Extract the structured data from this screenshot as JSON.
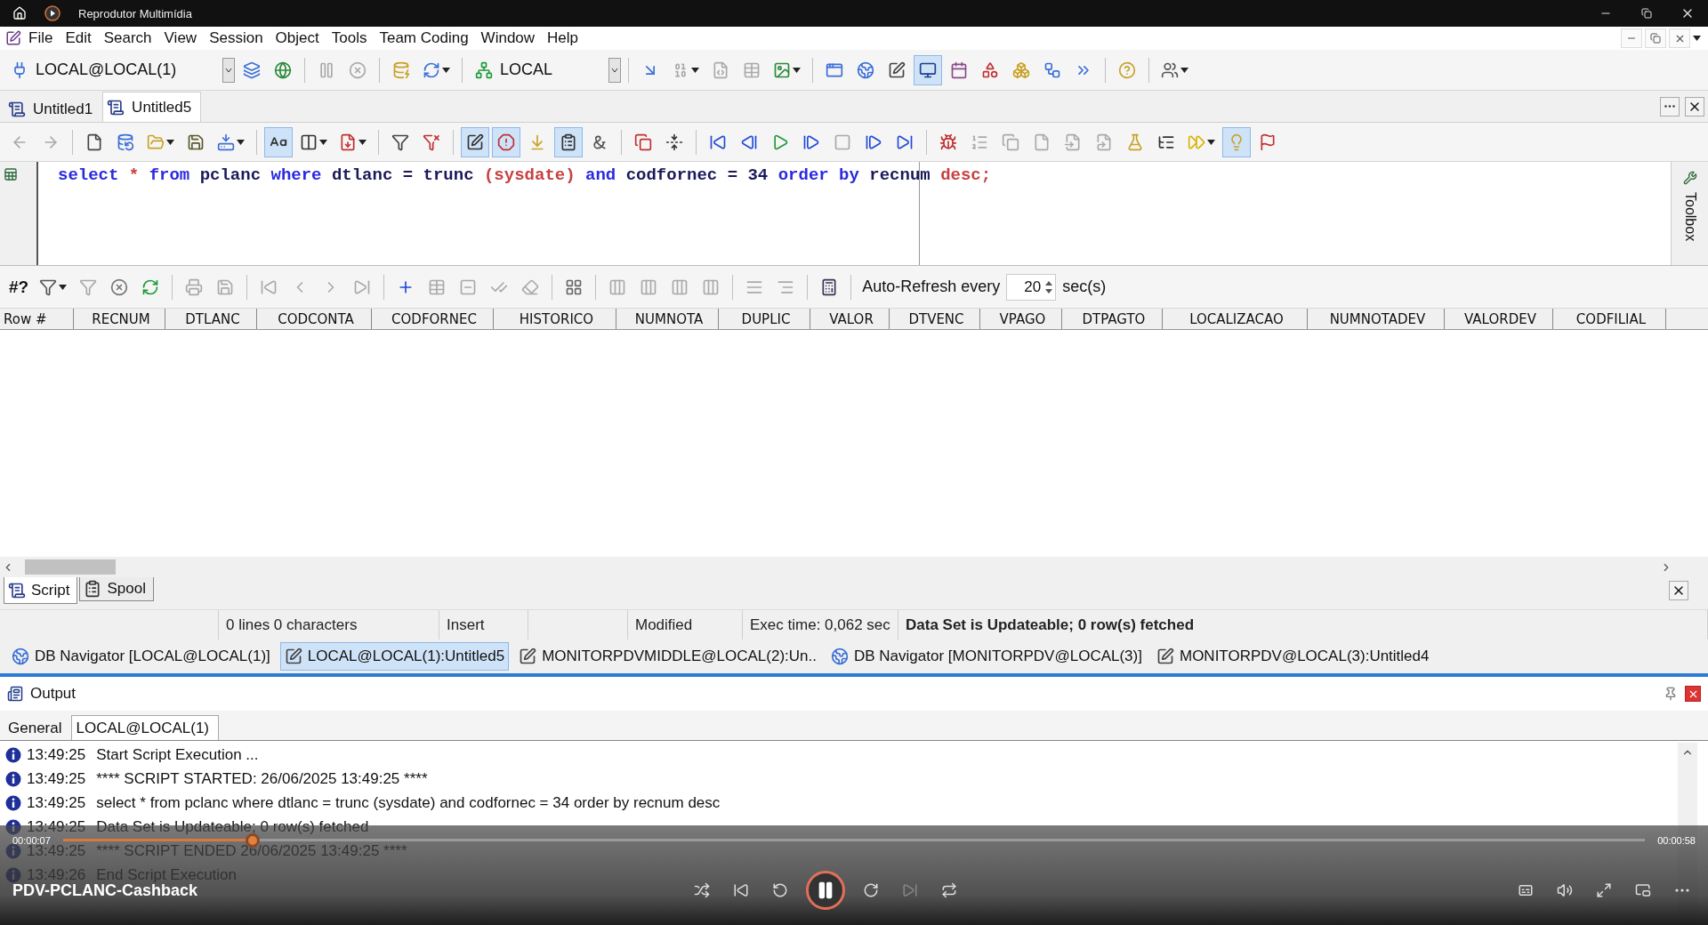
{
  "player": {
    "title": "Reprodutor Multimídia",
    "video_title": "PDV-PCLANC-Cashback",
    "elapsed": "00:00:07",
    "duration": "00:00:58",
    "level": 0.12,
    "playing": true
  },
  "menu": [
    "File",
    "Edit",
    "Search",
    "View",
    "Session",
    "Object",
    "Tools",
    "Team Coding",
    "Window",
    "Help"
  ],
  "main_toolbar": [
    {
      "kind": "combo",
      "label": "LOCAL@LOCAL(1)"
    },
    {
      "kind": "button",
      "pressed": false,
      "disabled": false
    },
    {
      "kind": "button",
      "pressed": false,
      "disabled": false
    },
    {
      "kind": "separator"
    },
    {
      "kind": "button",
      "pressed": false,
      "disabled": true
    },
    {
      "kind": "button",
      "pressed": false,
      "disabled": true
    },
    {
      "kind": "separator"
    },
    {
      "kind": "button",
      "pressed": false,
      "disabled": false
    },
    {
      "kind": "dropdown",
      "pressed": false,
      "disabled": false
    },
    {
      "kind": "separator"
    },
    {
      "kind": "combo",
      "label": "LOCAL"
    },
    {
      "kind": "separator"
    },
    {
      "kind": "button",
      "pressed": false,
      "disabled": false
    },
    {
      "kind": "dropdown",
      "pressed": false,
      "disabled": true
    },
    {
      "kind": "button",
      "pressed": false,
      "disabled": true
    },
    {
      "kind": "button",
      "pressed": false,
      "disabled": true
    },
    {
      "kind": "dropdown",
      "pressed": false,
      "disabled": false
    },
    {
      "kind": "separator"
    },
    {
      "kind": "button",
      "pressed": false,
      "disabled": false
    },
    {
      "kind": "button",
      "pressed": false,
      "disabled": false
    },
    {
      "kind": "button",
      "pressed": false,
      "disabled": false
    },
    {
      "kind": "button",
      "pressed": true,
      "disabled": false
    },
    {
      "kind": "button",
      "pressed": false,
      "disabled": false
    },
    {
      "kind": "button",
      "pressed": false,
      "disabled": false
    },
    {
      "kind": "button",
      "pressed": false,
      "disabled": false
    },
    {
      "kind": "button",
      "pressed": false,
      "disabled": false
    },
    {
      "kind": "button",
      "pressed": false,
      "disabled": false
    },
    {
      "kind": "separator"
    },
    {
      "kind": "button",
      "pressed": false,
      "disabled": false
    },
    {
      "kind": "separator"
    },
    {
      "kind": "dropdown",
      "pressed": false,
      "disabled": false
    }
  ],
  "doc_tabs": [
    {
      "label": "Untitled1",
      "selected": false
    },
    {
      "label": "Untitled5",
      "selected": true
    }
  ],
  "editor_toolbar": [
    {
      "kind": "button",
      "pressed": false,
      "disabled": true
    },
    {
      "kind": "button",
      "pressed": false,
      "disabled": true
    },
    {
      "kind": "separator"
    },
    {
      "kind": "button",
      "pressed": false,
      "disabled": false
    },
    {
      "kind": "button",
      "pressed": false,
      "disabled": false
    },
    {
      "kind": "dropdown",
      "pressed": false,
      "disabled": false
    },
    {
      "kind": "button",
      "pressed": false,
      "disabled": false
    },
    {
      "kind": "dropdown",
      "pressed": false,
      "disabled": false
    },
    {
      "kind": "separator"
    },
    {
      "kind": "button",
      "pressed": true,
      "disabled": false
    },
    {
      "kind": "dropdown",
      "pressed": false,
      "disabled": false
    },
    {
      "kind": "dropdown",
      "pressed": false,
      "disabled": false
    },
    {
      "kind": "separator"
    },
    {
      "kind": "button",
      "pressed": false,
      "disabled": false
    },
    {
      "kind": "button",
      "pressed": false,
      "disabled": false
    },
    {
      "kind": "separator"
    },
    {
      "kind": "button",
      "pressed": true,
      "disabled": false
    },
    {
      "kind": "button",
      "pressed": true,
      "disabled": false
    },
    {
      "kind": "button",
      "pressed": false,
      "disabled": false
    },
    {
      "kind": "button",
      "pressed": true,
      "disabled": false
    },
    {
      "kind": "button",
      "pressed": false,
      "disabled": false
    },
    {
      "kind": "separator"
    },
    {
      "kind": "button",
      "pressed": false,
      "disabled": false
    },
    {
      "kind": "button",
      "pressed": false,
      "disabled": false
    },
    {
      "kind": "separator"
    },
    {
      "kind": "button",
      "pressed": false,
      "disabled": false
    },
    {
      "kind": "button",
      "pressed": false,
      "disabled": false
    },
    {
      "kind": "button",
      "pressed": false,
      "disabled": false
    },
    {
      "kind": "button",
      "pressed": false,
      "disabled": false
    },
    {
      "kind": "button",
      "pressed": false,
      "disabled": true
    },
    {
      "kind": "button",
      "pressed": false,
      "disabled": false
    },
    {
      "kind": "button",
      "pressed": false,
      "disabled": false
    },
    {
      "kind": "separator"
    },
    {
      "kind": "button",
      "pressed": false,
      "disabled": false
    },
    {
      "kind": "button",
      "pressed": false,
      "disabled": true
    },
    {
      "kind": "button",
      "pressed": false,
      "disabled": true
    },
    {
      "kind": "button",
      "pressed": false,
      "disabled": true
    },
    {
      "kind": "button",
      "pressed": false,
      "disabled": true
    },
    {
      "kind": "button",
      "pressed": false,
      "disabled": true
    },
    {
      "kind": "button",
      "pressed": false,
      "disabled": false
    },
    {
      "kind": "button",
      "pressed": false,
      "disabled": false
    },
    {
      "kind": "dropdown",
      "pressed": false,
      "disabled": false
    },
    {
      "kind": "button",
      "pressed": true,
      "disabled": false
    },
    {
      "kind": "button",
      "pressed": false,
      "disabled": false
    }
  ],
  "editor": {
    "tokens": [
      {
        "kind": "keyword",
        "text": "select"
      },
      {
        "kind": "special",
        "text": "*"
      },
      {
        "kind": "keyword",
        "text": "from"
      },
      {
        "kind": "plain",
        "text": "pclanc"
      },
      {
        "kind": "keyword",
        "text": "where"
      },
      {
        "kind": "plain",
        "text": "dtlanc"
      },
      {
        "kind": "plain",
        "text": "="
      },
      {
        "kind": "plain",
        "text": "trunc"
      },
      {
        "kind": "special",
        "text": "(sysdate)"
      },
      {
        "kind": "keyword",
        "text": "and"
      },
      {
        "kind": "plain",
        "text": "codfornec"
      },
      {
        "kind": "plain",
        "text": "="
      },
      {
        "kind": "plain",
        "text": "34"
      },
      {
        "kind": "keyword",
        "text": "order by"
      },
      {
        "kind": "plain",
        "text": "recnum"
      },
      {
        "kind": "special",
        "text": "desc;"
      }
    ]
  },
  "toolbox": "Toolbox",
  "grid_toolbar": [
    {
      "kind": "title",
      "label": "#?"
    },
    {
      "kind": "dropdown",
      "pressed": false,
      "disabled": false
    },
    {
      "kind": "button",
      "pressed": false,
      "disabled": true
    },
    {
      "kind": "button",
      "pressed": false,
      "disabled": false
    },
    {
      "kind": "button",
      "pressed": false,
      "disabled": false
    },
    {
      "kind": "separator"
    },
    {
      "kind": "button",
      "pressed": false,
      "disabled": true
    },
    {
      "kind": "button",
      "pressed": false,
      "disabled": true
    },
    {
      "kind": "separator"
    },
    {
      "kind": "button",
      "pressed": false,
      "disabled": true
    },
    {
      "kind": "button",
      "pressed": false,
      "disabled": true
    },
    {
      "kind": "button",
      "pressed": false,
      "disabled": true
    },
    {
      "kind": "button",
      "pressed": false,
      "disabled": true
    },
    {
      "kind": "separator"
    },
    {
      "kind": "button",
      "pressed": false,
      "disabled": false
    },
    {
      "kind": "button",
      "pressed": false,
      "disabled": true
    },
    {
      "kind": "button",
      "pressed": false,
      "disabled": true
    },
    {
      "kind": "button",
      "pressed": false,
      "disabled": true
    },
    {
      "kind": "button",
      "pressed": false,
      "disabled": true
    },
    {
      "kind": "separator"
    },
    {
      "kind": "button",
      "pressed": false,
      "disabled": false
    },
    {
      "kind": "separator"
    },
    {
      "kind": "button",
      "pressed": false,
      "disabled": true
    },
    {
      "kind": "button",
      "pressed": false,
      "disabled": true
    },
    {
      "kind": "button",
      "pressed": false,
      "disabled": true
    },
    {
      "kind": "button",
      "pressed": false,
      "disabled": true
    },
    {
      "kind": "separator"
    },
    {
      "kind": "button",
      "pressed": false,
      "disabled": true
    },
    {
      "kind": "button",
      "pressed": false,
      "disabled": true
    },
    {
      "kind": "separator"
    },
    {
      "kind": "button",
      "pressed": false,
      "disabled": false
    },
    {
      "kind": "separator"
    },
    {
      "kind": "text",
      "label": "Auto-Refresh every"
    },
    {
      "kind": "spin",
      "value": "20"
    },
    {
      "kind": "text",
      "label": "sec(s)"
    }
  ],
  "grid": {
    "columns": [
      "Row #",
      "RECNUM",
      "DTLANC",
      "CODCONTA",
      "CODFORNEC",
      "HISTORICO",
      "NUMNOTA",
      "DUPLIC",
      "VALOR",
      "DTVENC",
      "VPAGO",
      "DTPAGTO",
      "LOCALIZACAO",
      "NUMNOTADEV",
      "VALORDEV",
      "CODFILIAL"
    ]
  },
  "bottom_tabs": [
    {
      "label": "Script",
      "selected": true
    },
    {
      "label": "Spool",
      "selected": false
    }
  ],
  "status_bar": [
    {
      "kind": "plain",
      "text": "0 lines 0 characters"
    },
    {
      "kind": "plain",
      "text": "Insert"
    },
    {
      "kind": "plain",
      "text": "Modified"
    },
    {
      "kind": "plain",
      "text": "Exec time: 0,062 sec"
    },
    {
      "kind": "emphasis",
      "text": "Data Set is Updateable; 0 row(s) fetched"
    }
  ],
  "window_tabs": [
    {
      "kind": "navigator",
      "label": "DB Navigator [LOCAL@LOCAL(1)]",
      "selected": false
    },
    {
      "kind": "editor",
      "label": "LOCAL@LOCAL(1):Untitled5",
      "selected": true
    },
    {
      "kind": "editor",
      "label": "MONITORPDVMIDDLE@LOCAL(2):Un..",
      "selected": false
    },
    {
      "kind": "navigator",
      "label": "DB Navigator [MONITORPDV@LOCAL(3)]",
      "selected": false
    },
    {
      "kind": "editor",
      "label": "MONITORPDV@LOCAL(3):Untitled4",
      "selected": false
    }
  ],
  "output": {
    "title": "Output",
    "tabs": [
      {
        "label": "General",
        "selected": false
      },
      {
        "label": "LOCAL@LOCAL(1)",
        "selected": true
      }
    ],
    "log": [
      {
        "time": "13:49:25",
        "message": "Start Script Execution ..."
      },
      {
        "time": "13:49:25",
        "message": "**** SCRIPT STARTED: 26/06/2025 13:49:25 ****"
      },
      {
        "time": "13:49:25",
        "message": "select * from pclanc where dtlanc = trunc (sysdate) and codfornec = 34 order by recnum desc"
      },
      {
        "time": "13:49:25",
        "message": "Data Set is Updateable; 0 row(s) fetched"
      },
      {
        "time": "13:49:25",
        "message": "**** SCRIPT ENDED 26/06/2025 13:49:25 ****"
      },
      {
        "time": "13:49:26",
        "message": "End Script Execution"
      }
    ]
  }
}
